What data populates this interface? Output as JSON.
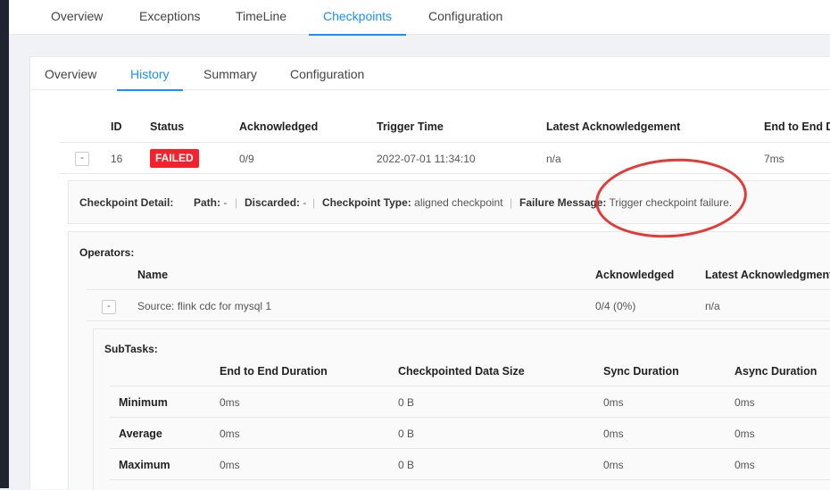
{
  "top_tabs": [
    "Overview",
    "Exceptions",
    "TimeLine",
    "Checkpoints",
    "Configuration"
  ],
  "sub_tabs": [
    "Overview",
    "History",
    "Summary",
    "Configuration"
  ],
  "history": {
    "headers": [
      "ID",
      "Status",
      "Acknowledged",
      "Trigger Time",
      "Latest Acknowledgement",
      "End to End D"
    ],
    "row": {
      "toggle": "-",
      "id": "16",
      "status": "FAILED",
      "acknowledged": "0/9",
      "trigger_time": "2022-07-01 11:34:10",
      "latest_ack": "n/a",
      "end_to_end": "7ms"
    }
  },
  "detail": {
    "label": "Checkpoint Detail:",
    "path_label": "Path:",
    "path_value": "-",
    "discarded_label": "Discarded:",
    "discarded_value": "-",
    "type_label": "Checkpoint Type:",
    "type_value": "aligned checkpoint",
    "failure_label": "Failure Message:",
    "failure_value": "Trigger checkpoint failure.",
    "separator": "|"
  },
  "operators": {
    "label": "Operators:",
    "headers": [
      "Name",
      "Acknowledged",
      "Latest Acknowledgment"
    ],
    "row": {
      "toggle": "-",
      "name": "Source: flink cdc for mysql 1",
      "acknowledged": "0/4 (0%)",
      "latest_ack": "n/a"
    }
  },
  "subtasks": {
    "label": "SubTasks:",
    "headers": [
      "End to End Duration",
      "Checkpointed Data Size",
      "Sync Duration",
      "Async Duration"
    ],
    "rows": [
      {
        "name": "Minimum",
        "e2e": "0ms",
        "size": "0 B",
        "sync": "0ms",
        "async": "0ms"
      },
      {
        "name": "Average",
        "e2e": "0ms",
        "size": "0 B",
        "sync": "0ms",
        "async": "0ms"
      },
      {
        "name": "Maximum",
        "e2e": "0ms",
        "size": "0 B",
        "sync": "0ms",
        "async": "0ms"
      }
    ]
  },
  "colors": {
    "accent": "#1890ff",
    "failed": "#f5222d",
    "annotation": "#e53935"
  }
}
